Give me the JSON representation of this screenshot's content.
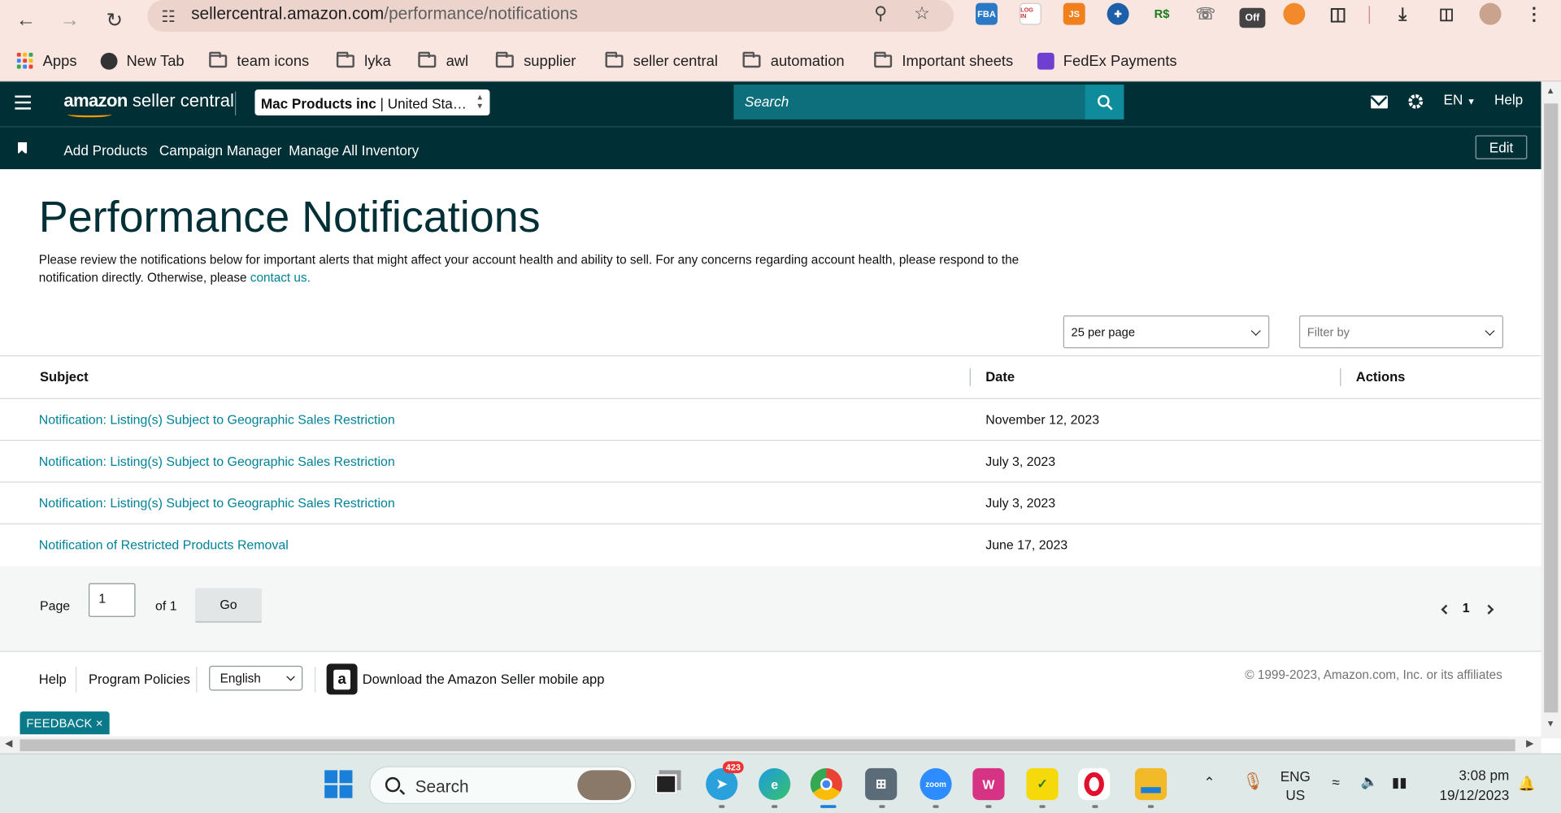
{
  "browser": {
    "url_domain": "sellercentral.amazon.com",
    "url_path": "/performance/notifications",
    "extensions": [
      "FBA",
      "LOG IN",
      "JS",
      "R$",
      "Off"
    ],
    "bookmarks": [
      {
        "label": "Apps",
        "type": "apps"
      },
      {
        "label": "New Tab",
        "type": "globe"
      },
      {
        "label": "team icons",
        "type": "folder"
      },
      {
        "label": "lyka",
        "type": "folder"
      },
      {
        "label": "awl",
        "type": "folder"
      },
      {
        "label": "supplier",
        "type": "folder"
      },
      {
        "label": "seller central",
        "type": "folder"
      },
      {
        "label": "automation",
        "type": "folder"
      },
      {
        "label": "Important sheets",
        "type": "folder"
      },
      {
        "label": "FedEx Payments",
        "type": "form"
      }
    ]
  },
  "header": {
    "logo_bold": "amazon",
    "logo_rest": " seller central",
    "account_name": "Mac Products inc",
    "account_sep": " | ",
    "account_market": "United Sta…",
    "search_placeholder": "Search",
    "lang": "EN",
    "help": "Help"
  },
  "subnav": {
    "links": [
      "Add Products",
      "Campaign Manager",
      "Manage All Inventory"
    ],
    "edit": "Edit"
  },
  "page": {
    "title": "Performance Notifications",
    "intro": "Please review the notifications below for important alerts that might affect your account health and ability to sell. For any concerns regarding account health, please respond to the notification directly. Otherwise, please ",
    "contact_link": "contact us.",
    "per_page": "25 per page",
    "filter_placeholder": "Filter by"
  },
  "table": {
    "headers": {
      "subject": "Subject",
      "date": "Date",
      "actions": "Actions"
    },
    "rows": [
      {
        "subject": "Notification: Listing(s) Subject to Geographic Sales Restriction",
        "date": "November 12, 2023"
      },
      {
        "subject": "Notification: Listing(s) Subject to Geographic Sales Restriction",
        "date": "July 3, 2023"
      },
      {
        "subject": "Notification: Listing(s) Subject to Geographic Sales Restriction",
        "date": "July 3, 2023"
      },
      {
        "subject": "Notification of Restricted Products Removal",
        "date": "June 17, 2023"
      }
    ]
  },
  "pagination": {
    "page_label": "Page",
    "page_value": "1",
    "of_label": "of 1",
    "go": "Go",
    "current": "1"
  },
  "footer": {
    "help": "Help",
    "policies": "Program Policies",
    "language": "English",
    "app_text": "Download the Amazon Seller mobile app",
    "copyright": "© 1999-2023, Amazon.com, Inc. or its affiliates",
    "feedback": "FEEDBACK ×"
  },
  "taskbar": {
    "search": "Search",
    "telegram_badge": "423",
    "zoom": "zoom",
    "lang_line1": "ENG",
    "lang_line2": "US",
    "time": "3:08 pm",
    "date": "19/12/2023"
  },
  "colors": {
    "header_bg": "#002f36",
    "link": "#008296",
    "title": "#002f36",
    "chrome_bg": "#f9e6e1"
  }
}
